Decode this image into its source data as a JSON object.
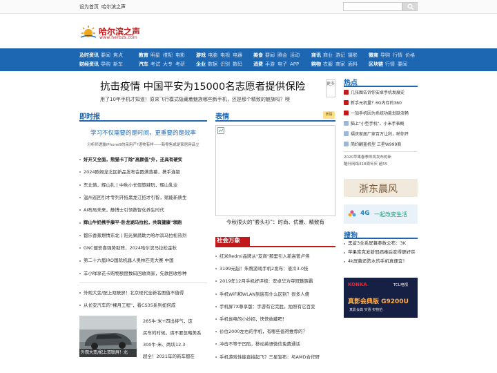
{
  "topbar": {
    "set_home": "设为首页",
    "site_voice": "哈尔滨之声"
  },
  "search": {
    "placeholder": ""
  },
  "logo": {
    "name": "哈尔滨之声",
    "url": "www.herbzs.com"
  },
  "nav": {
    "groups": [
      {
        "rows": [
          {
            "head": "及时资讯",
            "items": [
              "要闻",
              "焦点"
            ]
          },
          {
            "head": "财经资讯",
            "items": [
              "导购",
              "新车"
            ]
          }
        ]
      },
      {
        "rows": [
          {
            "head": "教育",
            "items": [
              "明星",
              "搭配",
              "电影"
            ]
          },
          {
            "head": "汽车",
            "items": [
              "考试",
              "大专",
              "考研"
            ]
          }
        ]
      },
      {
        "rows": [
          {
            "head": "游戏",
            "items": [
              "电脑",
              "电视",
              "电器"
            ]
          },
          {
            "head": "企业",
            "items": [
              "数据",
              "识别",
              "数码"
            ]
          }
        ]
      },
      {
        "rows": [
          {
            "head": "美食",
            "items": [
              "要闻",
              "腾会",
              "活动"
            ]
          },
          {
            "head": "消费",
            "items": [
              "手游",
              "电子",
              "APP"
            ]
          }
        ]
      },
      {
        "rows": [
          {
            "head": "商讯",
            "items": [
              "商业",
              "游记",
              "摄影"
            ]
          },
          {
            "head": "购物",
            "items": [
              "衣服",
              "商家",
              "面料"
            ]
          }
        ]
      },
      {
        "rows": [
          {
            "head": "微商",
            "items": [
              "导购",
              "行情",
              "价格"
            ]
          },
          {
            "head": "区块链",
            "items": [
              "行情",
              "要闻"
            ]
          }
        ]
      }
    ]
  },
  "headline": {
    "title": "抗击疫情 中国平安为15000名志愿者提供保险",
    "more": "更多",
    "sub": "用了10年手机才知道！原来飞行模式隐藏着魅族哪些新手机，还是那个精致的魅族吗？噢"
  },
  "left": {
    "title": "即时报",
    "lead_title": "学习不仅需要的是时间，更重要的是效率",
    "lead_sub": "分析师透露iPhone9的采用产?语物有样——新零售或是家居用品立",
    "list1": [
      {
        "text": "好开又全面，熊猫卡丁除\"高颜值\"外，还具有硬实",
        "bold": true
      },
      {
        "text": "2024欧姆龙北区新品发布会圆满落幕，携手连锁",
        "bold": false
      },
      {
        "text": "东北情，辉山礼 | 中秋小长假旅肆玩，辉山乳业",
        "bold": false
      },
      {
        "text": "温州巡回引才专列开抵黑龙江招才引智，赋能新质生",
        "bold": false
      },
      {
        "text": "AI布局未来，静博士引领数智化养生时代",
        "bold": false
      },
      {
        "text": "辉山牛奶携手康平·卧龙湖马拉松，共筑健康\"领跑",
        "bold": true
      },
      {
        "text": "都乐香蕉燃情东北 | 阳光果蔬助力哈尔滨马拉松热烈",
        "bold": false
      },
      {
        "text": "GNC健安喜强势助阵，2024哈尔滨马拉松金秋",
        "bold": false
      },
      {
        "text": "第二十六届IRO国际机器人奥林匹克大赛 中国",
        "bold": false
      },
      {
        "text": "羊小咩享花卡购物额度数码回收商家，先款回收秒种",
        "bold": false
      }
    ],
    "list2": [
      "外观大变/配上双联屏！北京现代全新名图值不值得",
      "从长安汽车的\"裸月工程\"，看CS35系列如何成"
    ],
    "car_caption": "外观大变/配上双联屏！北",
    "car_text": [
      "285牛·米+四出排气，这",
      "买车的时候，请不要忽略美系",
      "300牛·米、两块12.3",
      "超全！2021年的新车都在"
    ]
  },
  "middle": {
    "title": "表情",
    "badge": "表情",
    "caption": "今秋很火的\"套头衫\"：时尚、优雅、精致有",
    "title2": "社会万象",
    "list": [
      "红米Redmi品牌从\"友商\"那里引入新高管卢伟",
      "3199元起！朱鹰游戏手机2发布：液冷3.0技",
      "2019年12月手机好评榜：安卓华为夺冠魅族霸",
      "手机WiFi和WLAN到底有什么区别？很多人傻",
      "手机屏7X尊享版：手游有它完胜，拍照有它百变",
      "手机省电的小妙招，快快收藏吧！",
      "价位2000左右的手机，有哪些值得推荐的？",
      "冲击不等于凹陷，移动英语微信免费通话",
      "手机游戏性能直接起飞？三星宣布：与AMD合作研"
    ]
  },
  "right": {
    "title": "热点",
    "list": [
      "几张图告诉你安卓手机发展史",
      "新手元机量？6G内存的360",
      "一加手机因为系统功能划缺流畅",
      "脑上\"小型手机\"，小米手表概",
      "福庆家居厂家百万让利，啪你开",
      "简约翻盖机型 三星W999商"
    ],
    "promo": [
      "2020苹果春季即将发布的新",
      "酷升网络418周年庆 超55"
    ],
    "banner1_text": "浙东晨风",
    "banner2_text": "一起改变生活",
    "banner2_logo": "4G",
    "title2": "搜狗",
    "list2": [
      "黑鲨3全系屏幕参数公布：3K",
      "苹果库克发新冠病毒后变得更好实",
      "4k屏幕还防水的手机真便宜！"
    ],
    "banner3_brand": "KONKA",
    "banner3_brand2": "TCL电视",
    "banner3_text": "真影会典版 G9200U",
    "banner3_sub": "真影会典 实惠 实物拍"
  },
  "colors": {
    "brand_blue": "#1d66b2",
    "brand_red": "#c2181b"
  }
}
